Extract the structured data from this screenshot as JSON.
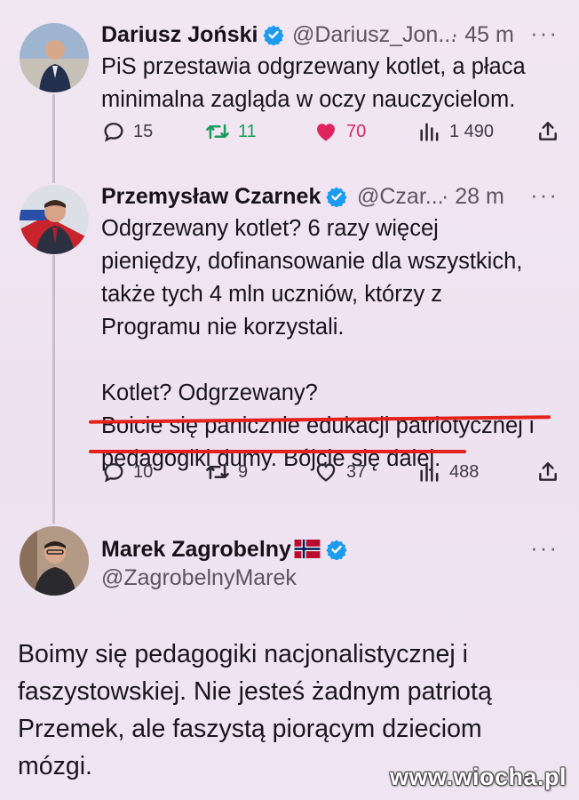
{
  "tweets": [
    {
      "name": "Dariusz Joński",
      "handle": "@Dariusz_Jon...",
      "time": "· 45 m",
      "lines": [
        "PiS przestawia odgrzewany kotlet, a płaca",
        "minimalna zagląda w oczy nauczycielom."
      ],
      "replies": "15",
      "reposts": "11",
      "likes": "70",
      "views": "1 490"
    },
    {
      "name": "Przemysław Czarnek",
      "handle": "@Czar...",
      "time": "· 28 m",
      "lines": [
        "Odgrzewany kotlet? 6 razy więcej",
        "pieniędzy, dofinansowanie dla wszystkich,",
        "także tych 4 mln uczniów, którzy z",
        "Programu nie korzystali.",
        "",
        "Kotlet? Odgrzewany?",
        "Boicie się panicznie edukacji patriotycznej i",
        "pedagogiki dumy. Bójcie się dalej."
      ],
      "replies": "10",
      "reposts": "9",
      "likes": "37",
      "views": "488"
    },
    {
      "name": "Marek Zagrobelny",
      "handle": "@ZagrobelnyMarek",
      "lines": [
        "Boimy się pedagogiki nacjonalistycznej i",
        "faszystowskiej. Nie jesteś żadnym patriotą",
        "Przemek, ale faszystą piorącym dzieciom",
        "mózgi."
      ]
    }
  ],
  "more_label": "···",
  "watermark": "www.wiocha.pl",
  "colors": {
    "repost_green": "#1a9b5b",
    "like_pink": "#e0245e",
    "verified_blue": "#1d9bf0",
    "underline_red": "#e4221c"
  }
}
